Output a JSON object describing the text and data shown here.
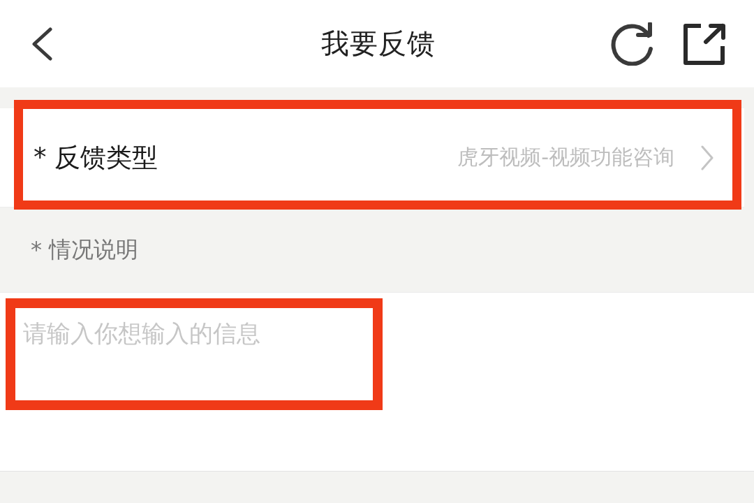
{
  "header": {
    "title": "我要反馈"
  },
  "feedback_type": {
    "label": "* 反馈类型",
    "value": "虎牙视频-视频功能咨询",
    "highlighted": true
  },
  "description": {
    "label": "* 情况说明",
    "placeholder": "请输入你想输入的信息",
    "highlighted": true
  }
}
